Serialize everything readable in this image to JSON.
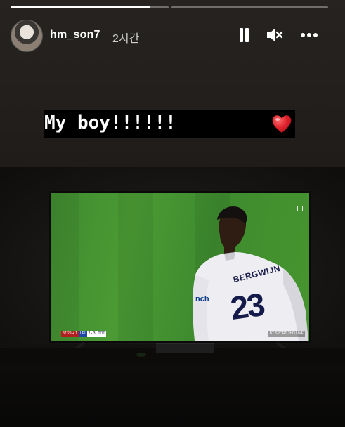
{
  "story": {
    "progress": [
      {
        "name": "segment-1",
        "fill_fraction": 0.88
      },
      {
        "name": "segment-2",
        "fill_fraction": 0.0
      }
    ],
    "user": {
      "username": "hm_son7",
      "timestamp": "2시간",
      "avatar_icon": "profile-avatar"
    },
    "controls": {
      "pause_icon": "pause-icon",
      "mute_icon": "volume-muted-icon",
      "more_icon": "more-options-icon"
    },
    "caption": {
      "text": "My boy!!!!!!",
      "emoji": "heart-emoji",
      "emoji_color": "#e0242e"
    }
  },
  "tv_broadcast": {
    "jersey_name": "BERGWIJN",
    "jersey_number": "23",
    "sponsor_fragment": "nch",
    "scorebug": {
      "time": "87:29 + 1",
      "home": "LEI",
      "score": "2 - 3",
      "away": "TOT"
    },
    "broadcaster": "BT SPORT 2HD LIVE"
  },
  "colors": {
    "pitch_green": "#45932f",
    "background": "#1c1a18",
    "caption_bg": "#000000"
  }
}
